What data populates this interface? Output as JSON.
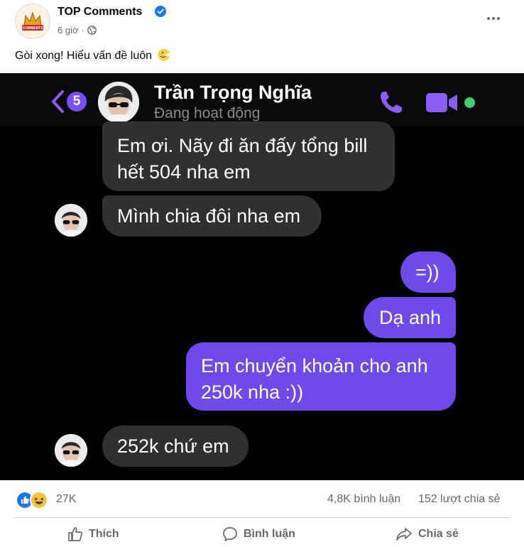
{
  "post": {
    "page_name": "TOP Comments",
    "time": "6 giờ",
    "separator": "·",
    "caption": "Gòi xong! Hiểu vấn đề luôn",
    "logo_text": "TOP COMMENTS"
  },
  "chat": {
    "unread_count": "5",
    "contact_name": "Trần Trọng Nghĩa",
    "contact_status": "Đang hoạt động",
    "messages": [
      {
        "side": "in",
        "text": "Em ơi. Nãy đi ăn đấy tổng bill\nhết 504 nha em"
      },
      {
        "side": "in",
        "text": "Mình chia đôi nha em"
      },
      {
        "side": "out",
        "text": "=))"
      },
      {
        "side": "out",
        "text": "Dạ anh"
      },
      {
        "side": "out",
        "text": "Em chuyển khoản cho anh\n250k nha :))"
      },
      {
        "side": "in",
        "text": "252k chứ em"
      }
    ]
  },
  "stats": {
    "reactions": [
      "like",
      "haha"
    ],
    "reaction_count": "27K",
    "comments": "4,8K bình luận",
    "shares": "152 lượt chia sẻ"
  },
  "actions": {
    "like": "Thích",
    "comment": "Bình luận",
    "share": "Chia sẻ"
  },
  "colors": {
    "outgoing_bubble": "#6f4aea",
    "incoming_bubble": "#303030",
    "accent_purple": "#8b5cf6",
    "online": "#3bd26b",
    "facebook_blue": "#1877f2"
  }
}
